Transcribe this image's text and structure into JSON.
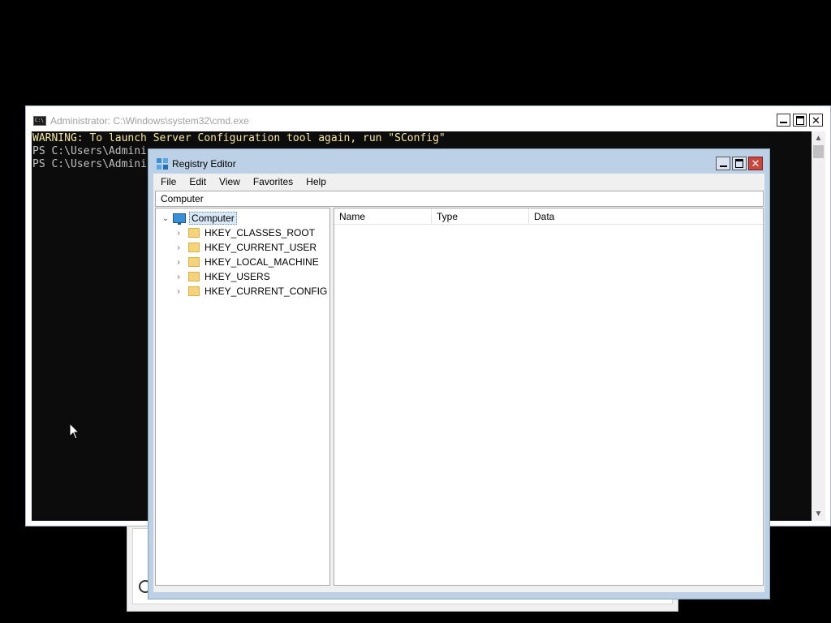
{
  "cmd": {
    "title": "Administrator: C:\\Windows\\system32\\cmd.exe",
    "lines": [
      "WARNING: To launch Server Configuration tool again, run \"SConfig\"",
      "PS C:\\Users\\Admini",
      "PS C:\\Users\\Admini"
    ]
  },
  "regedit": {
    "title": "Registry Editor",
    "menu": [
      "File",
      "Edit",
      "View",
      "Favorites",
      "Help"
    ],
    "address": "Computer",
    "tree": {
      "root": "Computer",
      "keys": [
        "HKEY_CLASSES_ROOT",
        "HKEY_CURRENT_USER",
        "HKEY_LOCAL_MACHINE",
        "HKEY_USERS",
        "HKEY_CURRENT_CONFIG"
      ]
    },
    "columns": {
      "name": "Name",
      "type": "Type",
      "data": "Data"
    }
  },
  "icons": {
    "chevron_collapsed": "›",
    "chevron_expanded": "⌄",
    "close": "✕"
  }
}
